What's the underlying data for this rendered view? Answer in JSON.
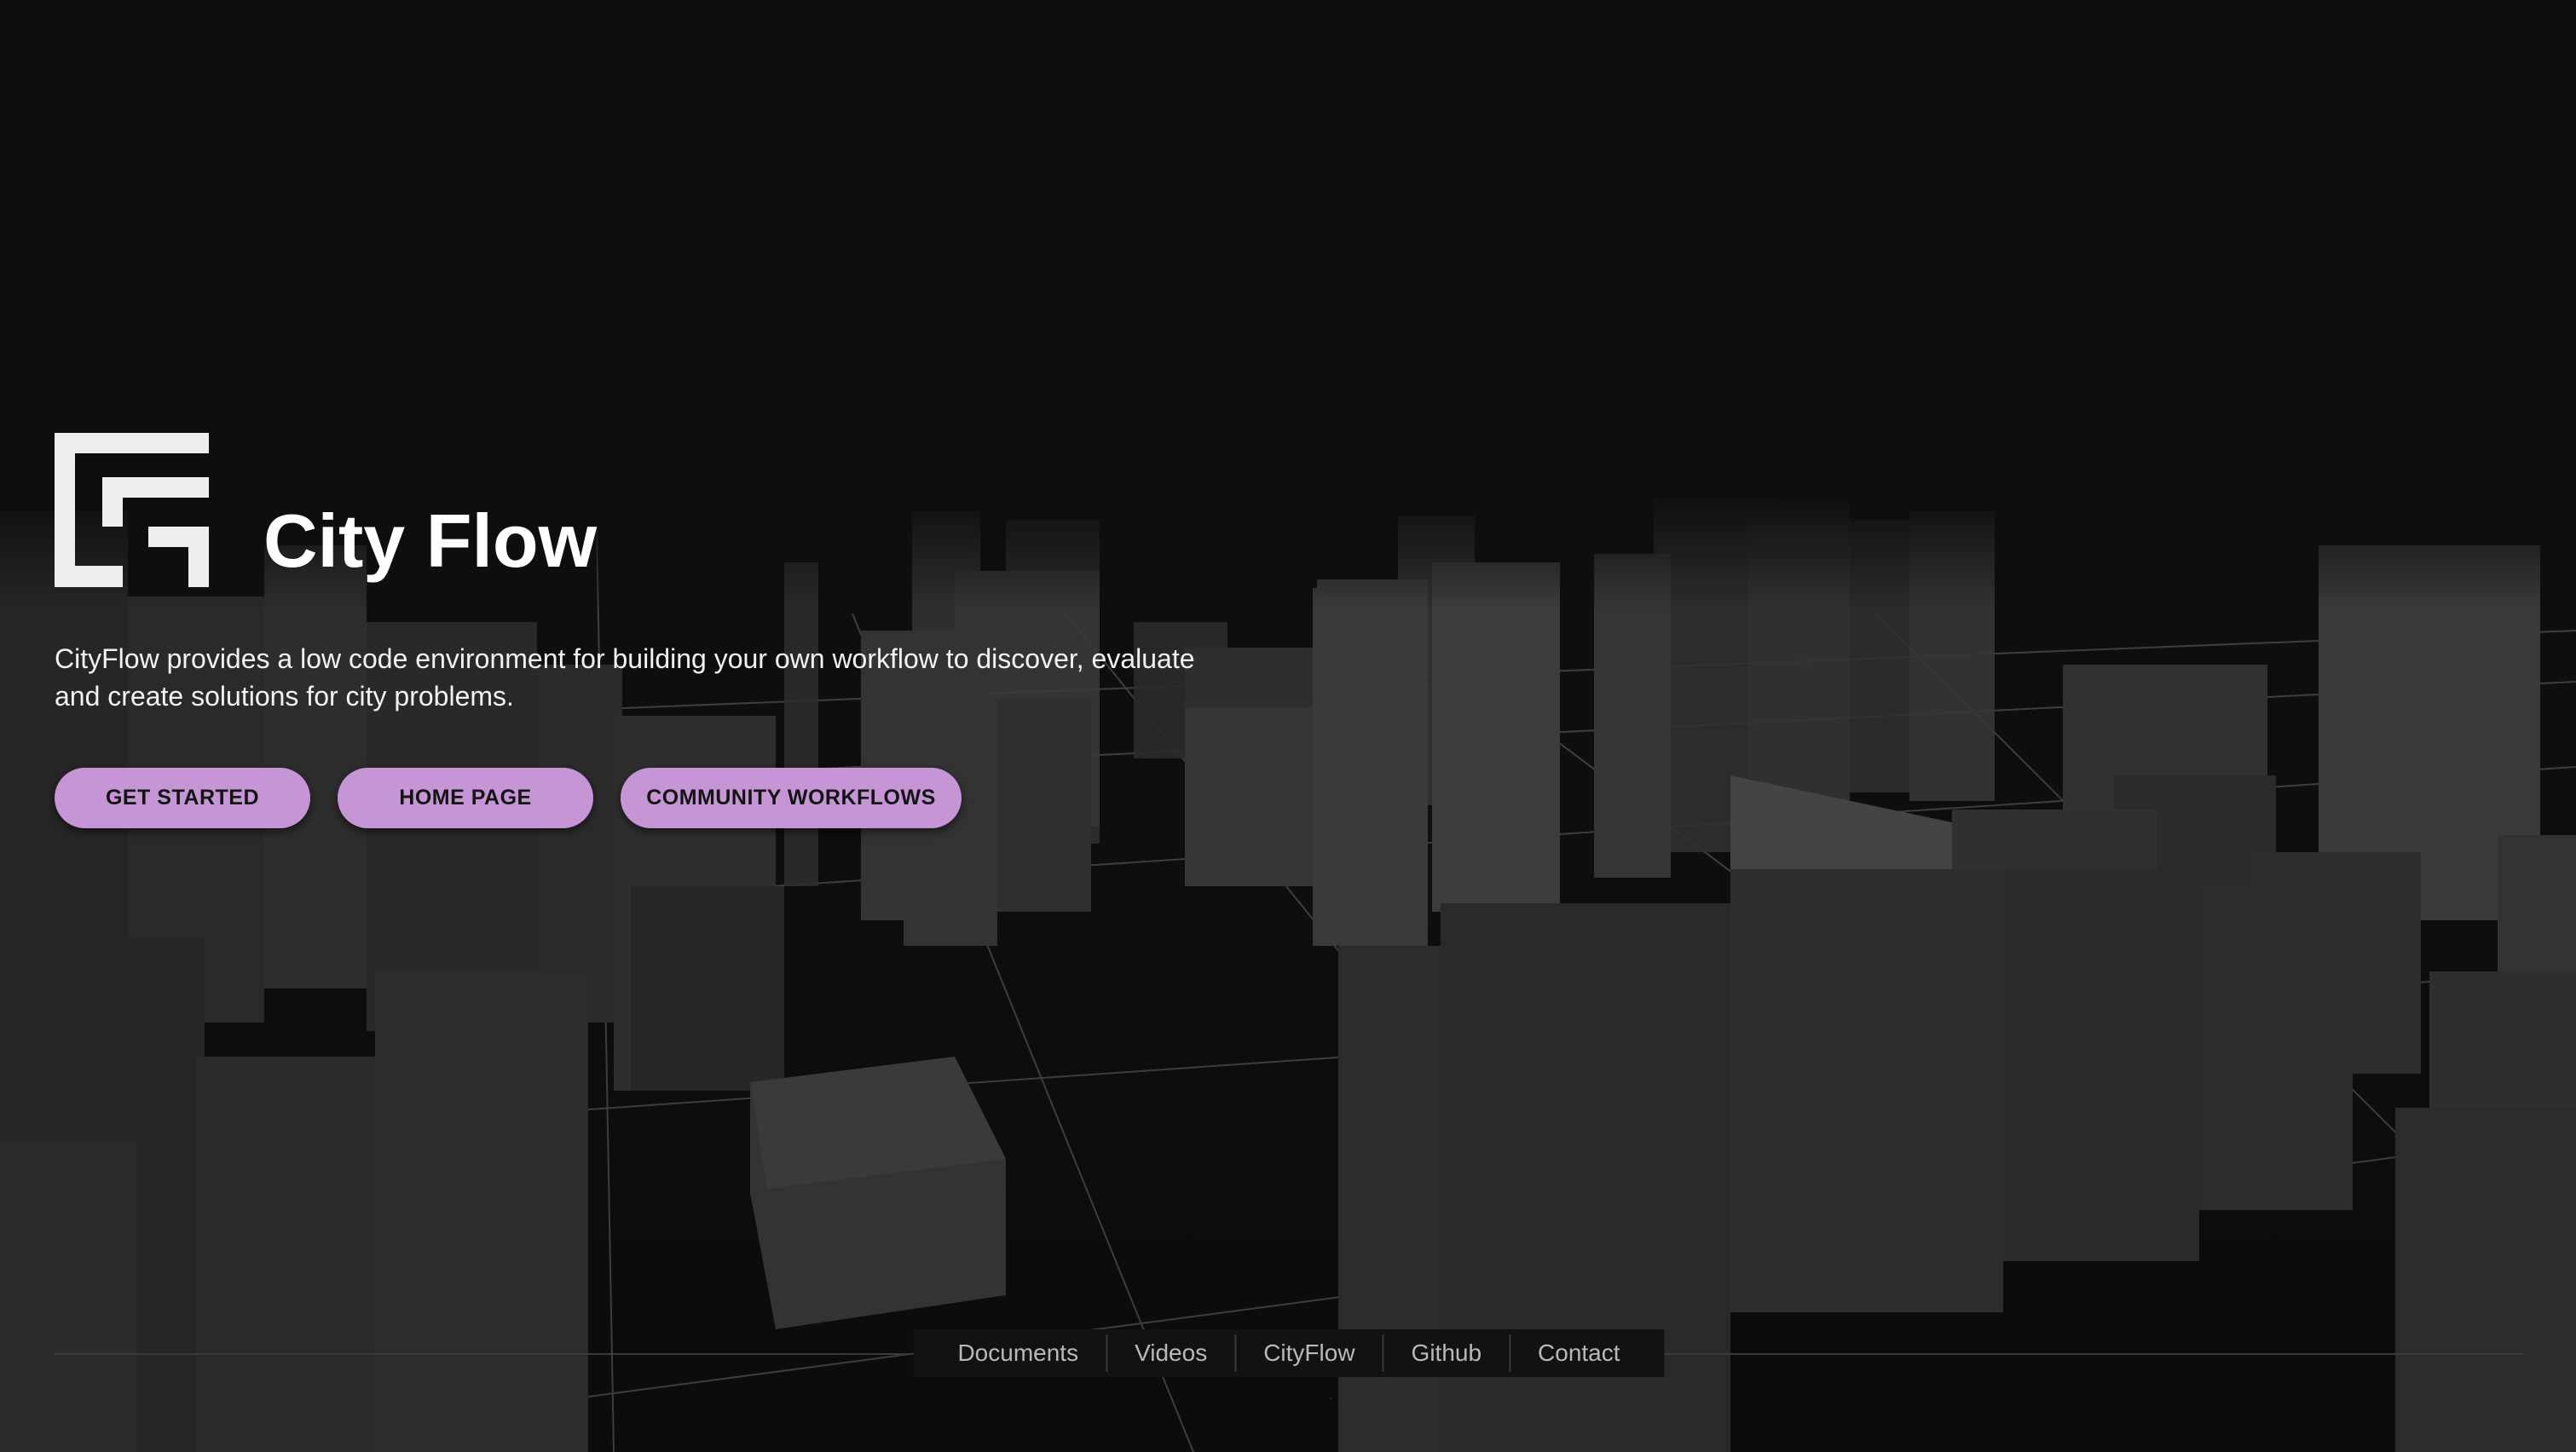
{
  "app": {
    "title": "City Flow",
    "description": "CityFlow provides a low code environment for building your own workflow to discover, evaluate and create solutions for city problems."
  },
  "buttons": {
    "get_started": "GET STARTED",
    "home_page": "HOME PAGE",
    "community_workflows": "COMMUNITY WORKFLOWS"
  },
  "footer": {
    "links": [
      "Documents",
      "Videos",
      "CityFlow",
      "Github",
      "Contact"
    ]
  },
  "colors": {
    "background": "#0e0e0e",
    "accent": "#c695d6",
    "text": "#ffffff",
    "footer_text": "#b9b9b9"
  },
  "icons": {
    "logo": "cityflow-logo-icon",
    "background": "city-blocks-3d-scene"
  }
}
